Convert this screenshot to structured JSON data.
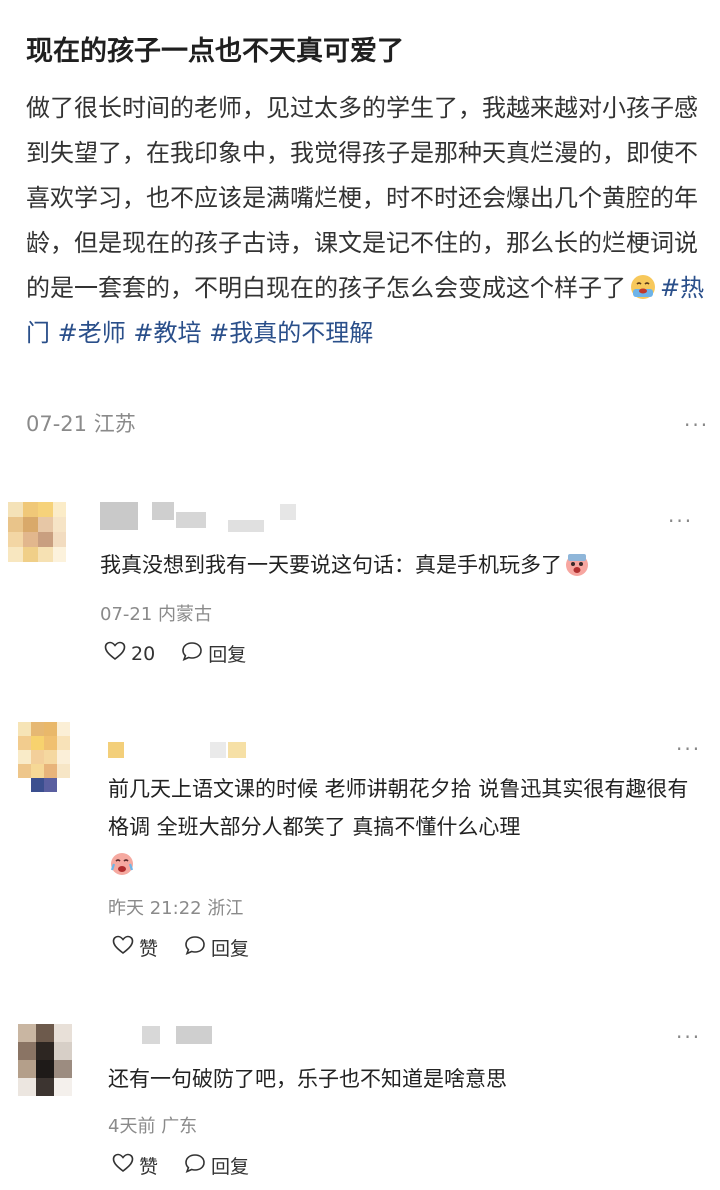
{
  "post": {
    "title": "现在的孩子一点也不天真可爱了",
    "body": "做了很长时间的老师，见过太多的学生了，我越来越对小孩子感到失望了，在我印象中，我觉得孩子是那种天真烂漫的，即使不喜欢学习，也不应该是满嘴烂梗，时不时还会爆出几个黄腔的年龄，但是现在的孩子古诗，课文是记不住的，那么长的烂梗词说的是一套套的，不明白现在的孩子怎么会变成这个样子了",
    "emoji_icon": "crying-emoji-icon",
    "tags": [
      "#热门",
      "#老师",
      "#教培",
      "#我真的不理解"
    ],
    "date": "07-21",
    "location": "江苏",
    "more_label": "···"
  },
  "comments": [
    {
      "text": "我真没想到我有一天要说这句话：真是手机玩多了",
      "emoji_icon": "shocked-emoji-icon",
      "date": "07-21",
      "location": "内蒙古",
      "like_label": "20",
      "reply_label": "回复",
      "more_label": "···"
    },
    {
      "text": "前几天上语文课的时候 老师讲朝花夕拾 说鲁迅其实很有趣很有格调 全班大部分人都笑了 真搞不懂什么心理",
      "emoji_icon": "crying-emoji-icon",
      "time": "昨天 21:22",
      "location": "浙江",
      "like_label": "赞",
      "reply_label": "回复",
      "more_label": "···"
    },
    {
      "text": "还有一句破防了吧，乐子也不知道是啥意思",
      "time": "4天前",
      "location": "广东",
      "like_label": "赞",
      "reply_label": "回复",
      "more_label": "···"
    }
  ],
  "colors": {
    "tag": "#2a4f8a",
    "meta": "#8a8a8a",
    "text": "#222222"
  }
}
